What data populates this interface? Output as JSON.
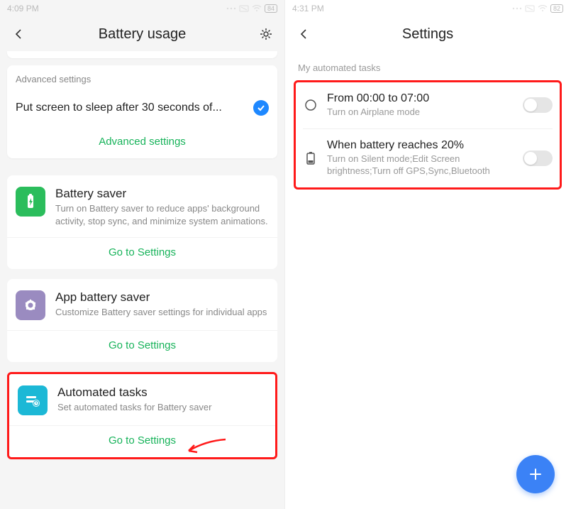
{
  "left": {
    "status_time": "4:09 PM",
    "battery_pct": "84",
    "header_title": "Battery  usage",
    "advanced_label": "Advanced settings",
    "sleep_setting": "Put screen to sleep after 30 seconds of...",
    "advanced_link": "Advanced settings",
    "cards": [
      {
        "title": "Battery saver",
        "desc": "Turn on Battery saver to reduce apps' background activity, stop sync, and minimize system animations.",
        "link": "Go to Settings"
      },
      {
        "title": "App battery saver",
        "desc": "Customize Battery saver settings for individual apps",
        "link": "Go to Settings"
      },
      {
        "title": "Automated tasks",
        "desc": "Set automated tasks for Battery saver",
        "link": "Go to Settings"
      }
    ]
  },
  "right": {
    "status_time": "4:31 PM",
    "battery_pct": "82",
    "header_title": "Settings",
    "section_label": "My automated tasks",
    "tasks": [
      {
        "title": "From 00:00 to 07:00",
        "desc": "Turn on Airplane mode"
      },
      {
        "title": "When battery reaches 20%",
        "desc": "Turn on Silent mode;Edit Screen brightness;Turn off GPS,Sync,Bluetooth"
      }
    ]
  }
}
